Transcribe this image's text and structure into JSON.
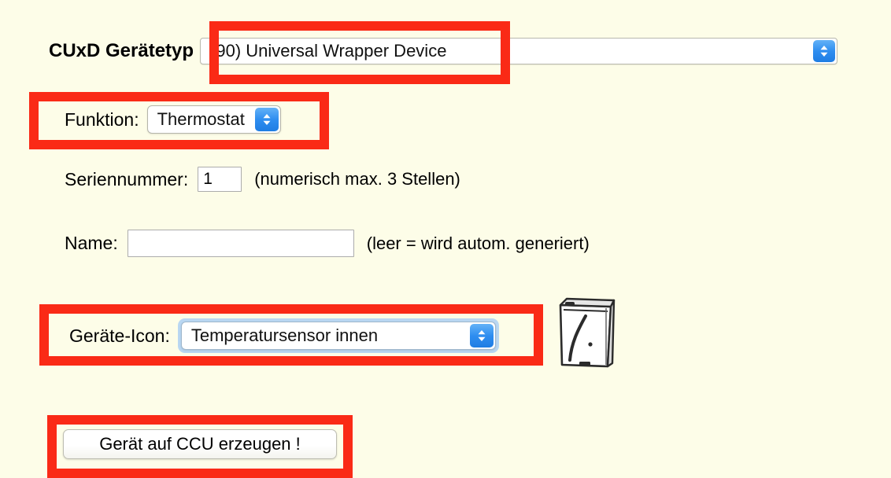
{
  "page": {
    "background_color": "#fdfde8",
    "annotation_color": "#fa2a16"
  },
  "form": {
    "device_type": {
      "label": "CUxD Gerätetyp",
      "selected": "(90) Universal Wrapper Device",
      "control": "select",
      "highlighted": true
    },
    "function": {
      "label": "Funktion:",
      "selected": "Thermostat",
      "control": "select",
      "highlighted": true
    },
    "serial_number": {
      "label": "Seriennummer:",
      "value": "1",
      "placeholder": "",
      "hint": "(numerisch max. 3 Stellen)"
    },
    "name": {
      "label": "Name:",
      "value": "",
      "placeholder": "",
      "hint": "(leer = wird autom. generiert)"
    },
    "device_icon": {
      "label": "Geräte-Icon:",
      "selected": "Temperatursensor innen",
      "control": "select",
      "highlighted": true,
      "preview_icon": "temperature-sensor-device-icon"
    },
    "submit": {
      "label": "Gerät auf CCU erzeugen !",
      "highlighted": true
    }
  },
  "icons": {
    "stepper": "up-down-chevron-icon"
  }
}
